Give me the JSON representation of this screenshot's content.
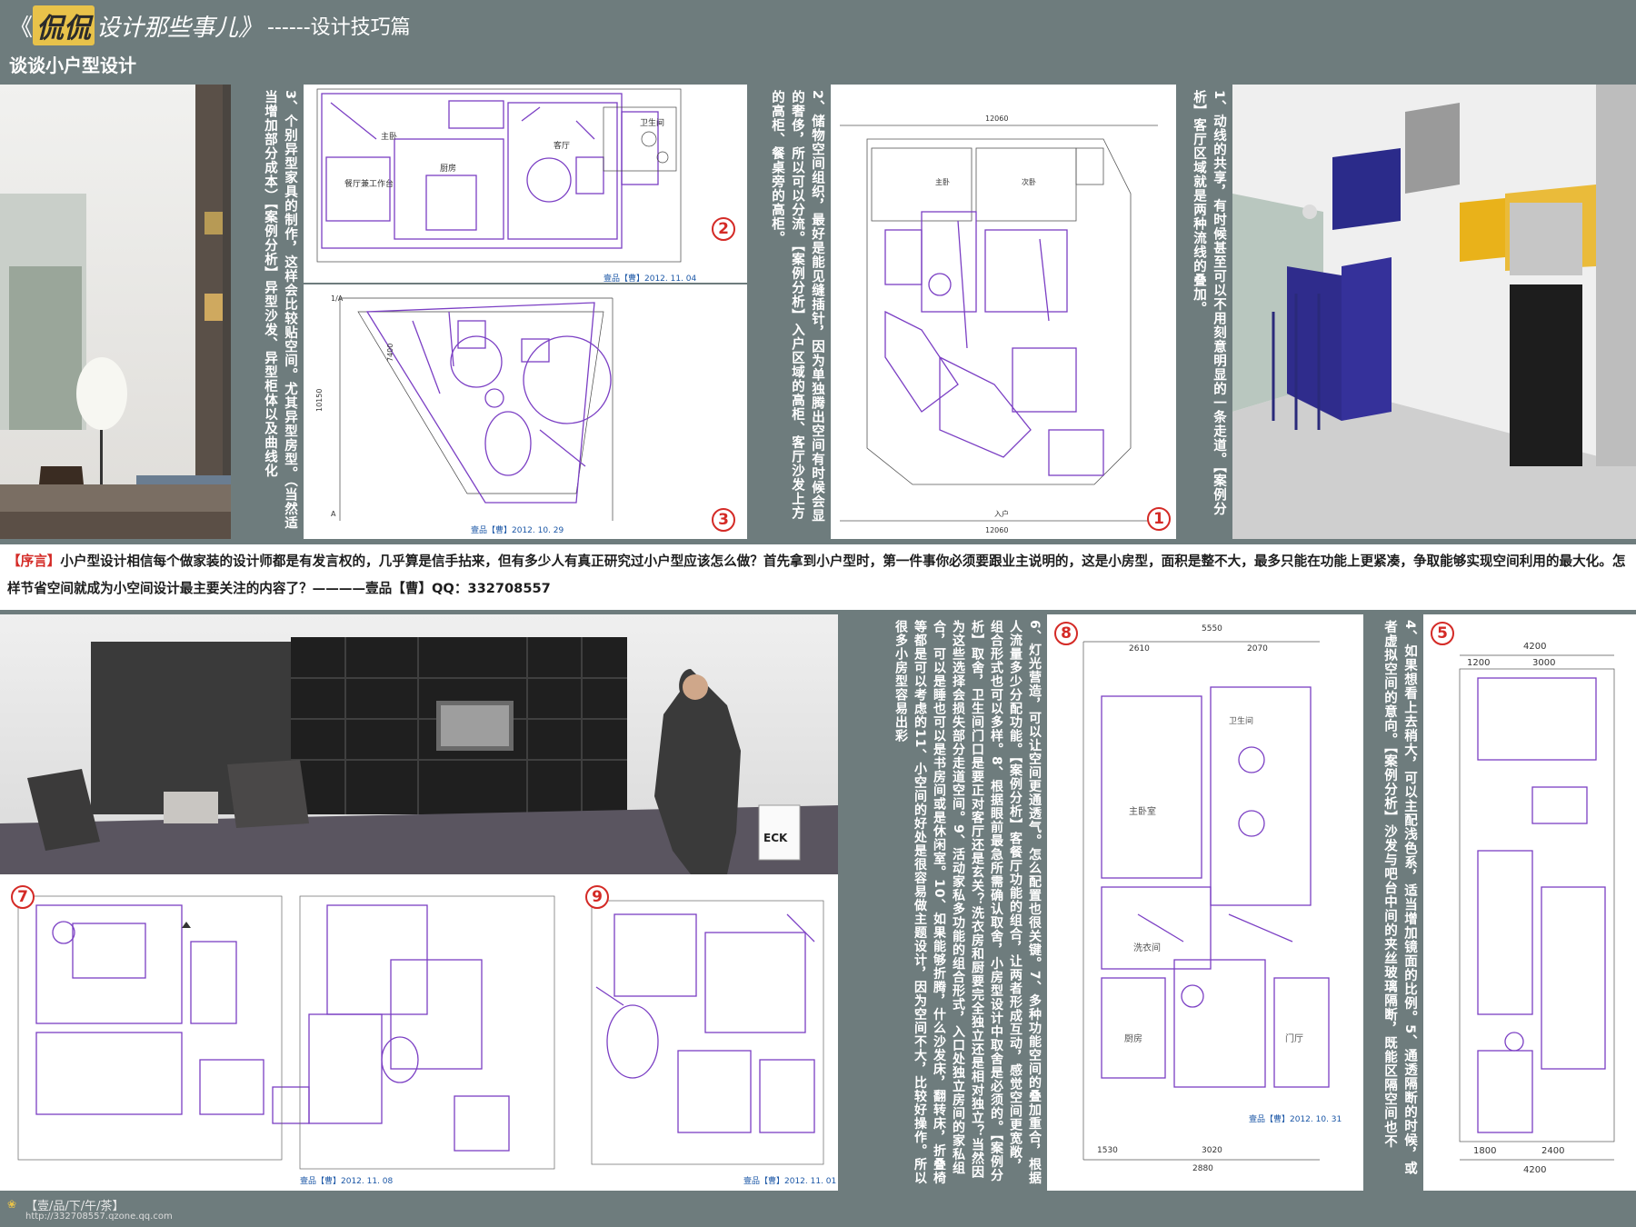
{
  "header": {
    "brand": "侃侃",
    "title_rest": "设计那些事儿》",
    "title_open": "《",
    "subtitle": "------设计技巧篇",
    "heading": "谈谈小户型设计"
  },
  "tips": {
    "t1": "1、动线的共享，有时候甚至可以不用刻意明显的一条走道。【案例分析】客厅区域就是两种流线的叠加。",
    "t2": "2、储物空间组织，最好是能见缝插针，因为单独腾出空间有时候会显的奢侈，所以可以分流。【案例分析】入户区域的高柜、客厅沙发上方的高柜、餐桌旁的高柜。",
    "t3": "3、个别异型家具的制作，这样会比较贴空间。尤其异型房型。（当然适当增加部分成本）【案例分析】异型沙发、异型柜体以及曲线化",
    "t45": "4、如果想看上去稍大，可以主配浅色系，适当增加镜面的比例。5、通透隔断的时候，或者虚拟空间的意向。【案例分析】沙发与吧台中间的夹丝玻璃隔断，既能区隔空间也不",
    "t68": "6、灯光营造，可以让空间更通透气。怎么配置也很关键。7、多种功能空间的叠加重合，根据人流量多少分配功能。【案例分析】客餐厅功能的组合，让两者形成互动，感觉空间更宽敞，组合形式也可以多样。8、根据眼前最急所需确认取舍，小房型设计中取舍是必须的。【案例分析】取舍，卫生间门口是要正对客厅还是玄关？洗衣房和厨要完全独立还是相对独立？当然因为这些选择会损失部分走道空间。9、活动家私多功能的组合形式，入口处独立房间的家私组合，可以是睡也可以是书房间或是休闲室。10、如果能够折腾，什么沙发床，翻转床，折叠椅等都是可以考虑的11、小空间的好处是很容易做主题设计，因为空间不大，比较好操作。所以很多小房型容易出彩"
  },
  "preface": {
    "label": "【序言】",
    "text": "小户型设计相信每个做家装的设计师都是有发言权的，几乎算是信手拈来，但有多少人有真正研究过小户型应该怎么做？首先拿到小户型时，第一件事你必须要跟业主说明的，这是小房型，面积是整不大，最多只能在功能上更紧凑，争取能够实现空间利用的最大化。怎样节省空间就成为小空间设计最主要关注的内容了？————壹品【曹】QQ：332708557"
  },
  "markers": {
    "m1": "1",
    "m2": "2",
    "m3": "3",
    "m5": "5",
    "m7": "7",
    "m8": "8",
    "m9": "9"
  },
  "captions": {
    "c2": "壹品【曹】2012. 11. 04",
    "c3": "壹品【曹】2012. 10. 29",
    "c8": "壹品【曹】2012. 10. 31",
    "c7": "壹品【曹】2012. 11. 08",
    "c9": "壹品【曹】2012. 11. 01"
  },
  "plan_labels": {
    "zhuwo": "主卧",
    "chufang": "厨房",
    "keting": "客厅",
    "weishengjian": "卫生间",
    "canting": "餐厅兼工作台",
    "ciwo": "次卧",
    "ruhu": "入户",
    "zhuwoshi": "主卧室",
    "xiyijian": "洗衣间",
    "chufang8": "厨房",
    "menting": "门厅",
    "weisheng8": "卫生间"
  },
  "dims": {
    "d8a": "5550",
    "d8b": "2610",
    "d8c": "2070",
    "d8d": "1530",
    "d8e": "3020",
    "d8f": "2880",
    "d5a": "4200",
    "d5b": "1200",
    "d5c": "3000",
    "d5d": "1800",
    "d5e": "2400",
    "d5f": "4200",
    "d1a": "12060",
    "d1b": "12060",
    "d3a": "7400",
    "d3b": "10150"
  },
  "footer": {
    "brand": "【壹/品/下/午/茶】",
    "url": "http://332708557.qzone.qq.com"
  },
  "colors": {
    "bg": "#6e7c7d",
    "accent_red": "#d42a26",
    "plan_purple": "#7b3fc4",
    "brand_gold": "#e8c24a"
  }
}
